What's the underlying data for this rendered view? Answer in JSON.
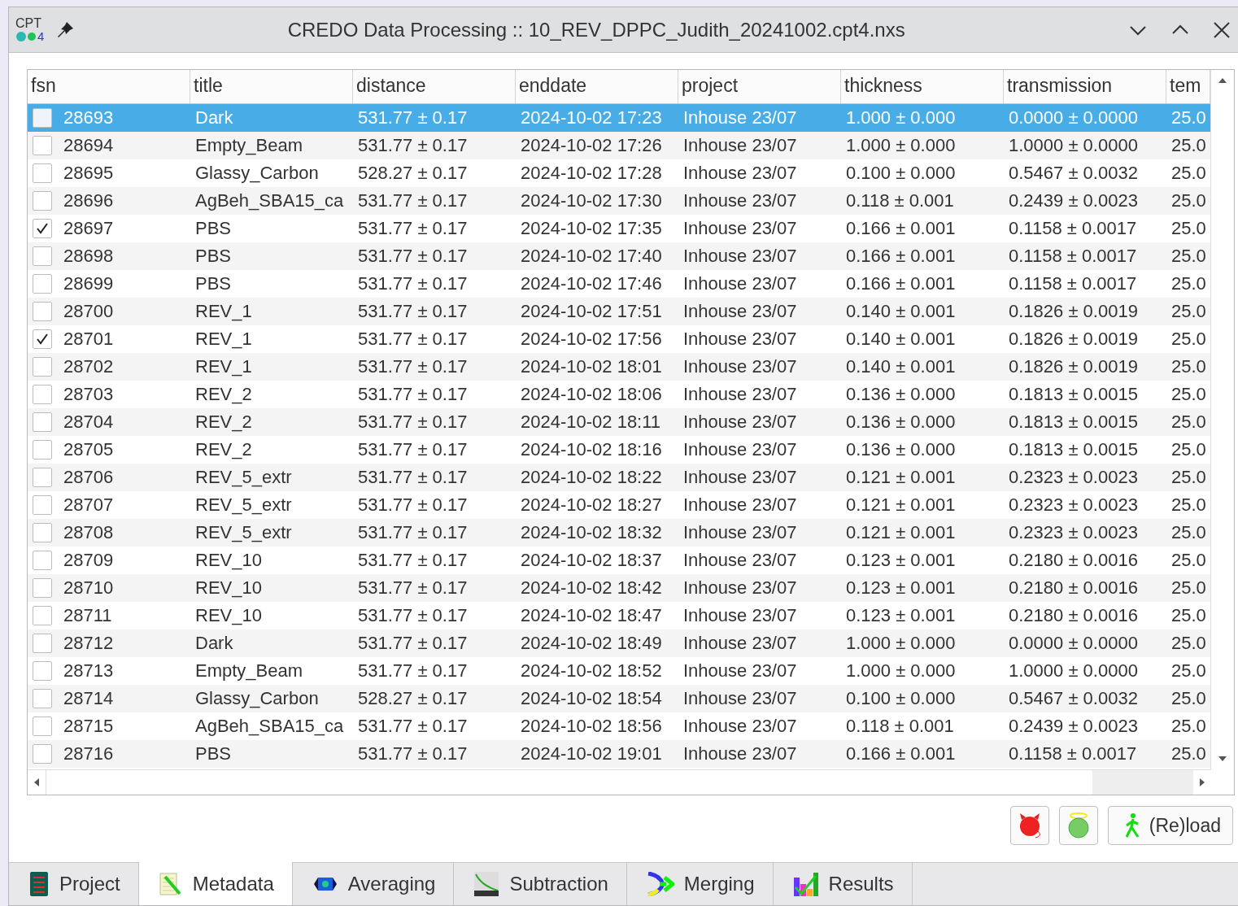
{
  "window": {
    "app_icon_text": "CPT",
    "app_icon_version": "4",
    "title": "CREDO Data Processing :: 10_REV_DPPC_Judith_20241002.cpt4.nxs"
  },
  "table": {
    "columns": [
      "fsn",
      "title",
      "distance",
      "enddate",
      "project",
      "thickness",
      "transmission",
      "tem"
    ],
    "rows": [
      {
        "checked": false,
        "selected": true,
        "cells": [
          "28693",
          "Dark",
          "531.77 ± 0.17",
          "2024-10-02 17:23",
          "Inhouse 23/07",
          "1.000 ± 0.000",
          "0.0000 ± 0.0000",
          "25.0"
        ]
      },
      {
        "checked": false,
        "selected": false,
        "cells": [
          "28694",
          "Empty_Beam",
          "531.77 ± 0.17",
          "2024-10-02 17:26",
          "Inhouse 23/07",
          "1.000 ± 0.000",
          "1.0000 ± 0.0000",
          "25.0"
        ]
      },
      {
        "checked": false,
        "selected": false,
        "cells": [
          "28695",
          "Glassy_Carbon",
          "528.27 ± 0.17",
          "2024-10-02 17:28",
          "Inhouse 23/07",
          "0.100 ± 0.000",
          "0.5467 ± 0.0032",
          "25.0"
        ]
      },
      {
        "checked": false,
        "selected": false,
        "cells": [
          "28696",
          "AgBeh_SBA15_ca",
          "531.77 ± 0.17",
          "2024-10-02 17:30",
          "Inhouse 23/07",
          "0.118 ± 0.001",
          "0.2439 ± 0.0023",
          "25.0"
        ]
      },
      {
        "checked": true,
        "selected": false,
        "cells": [
          "28697",
          "PBS",
          "531.77 ± 0.17",
          "2024-10-02 17:35",
          "Inhouse 23/07",
          "0.166 ± 0.001",
          "0.1158 ± 0.0017",
          "25.0"
        ]
      },
      {
        "checked": false,
        "selected": false,
        "cells": [
          "28698",
          "PBS",
          "531.77 ± 0.17",
          "2024-10-02 17:40",
          "Inhouse 23/07",
          "0.166 ± 0.001",
          "0.1158 ± 0.0017",
          "25.0"
        ]
      },
      {
        "checked": false,
        "selected": false,
        "cells": [
          "28699",
          "PBS",
          "531.77 ± 0.17",
          "2024-10-02 17:46",
          "Inhouse 23/07",
          "0.166 ± 0.001",
          "0.1158 ± 0.0017",
          "25.0"
        ]
      },
      {
        "checked": false,
        "selected": false,
        "cells": [
          "28700",
          "REV_1",
          "531.77 ± 0.17",
          "2024-10-02 17:51",
          "Inhouse 23/07",
          "0.140 ± 0.001",
          "0.1826 ± 0.0019",
          "25.0"
        ]
      },
      {
        "checked": true,
        "selected": false,
        "cells": [
          "28701",
          "REV_1",
          "531.77 ± 0.17",
          "2024-10-02 17:56",
          "Inhouse 23/07",
          "0.140 ± 0.001",
          "0.1826 ± 0.0019",
          "25.0"
        ]
      },
      {
        "checked": false,
        "selected": false,
        "cells": [
          "28702",
          "REV_1",
          "531.77 ± 0.17",
          "2024-10-02 18:01",
          "Inhouse 23/07",
          "0.140 ± 0.001",
          "0.1826 ± 0.0019",
          "25.0"
        ]
      },
      {
        "checked": false,
        "selected": false,
        "cells": [
          "28703",
          "REV_2",
          "531.77 ± 0.17",
          "2024-10-02 18:06",
          "Inhouse 23/07",
          "0.136 ± 0.000",
          "0.1813 ± 0.0015",
          "25.0"
        ]
      },
      {
        "checked": false,
        "selected": false,
        "cells": [
          "28704",
          "REV_2",
          "531.77 ± 0.17",
          "2024-10-02 18:11",
          "Inhouse 23/07",
          "0.136 ± 0.000",
          "0.1813 ± 0.0015",
          "25.0"
        ]
      },
      {
        "checked": false,
        "selected": false,
        "cells": [
          "28705",
          "REV_2",
          "531.77 ± 0.17",
          "2024-10-02 18:16",
          "Inhouse 23/07",
          "0.136 ± 0.000",
          "0.1813 ± 0.0015",
          "25.0"
        ]
      },
      {
        "checked": false,
        "selected": false,
        "cells": [
          "28706",
          "REV_5_extr",
          "531.77 ± 0.17",
          "2024-10-02 18:22",
          "Inhouse 23/07",
          "0.121 ± 0.001",
          "0.2323 ± 0.0023",
          "25.0"
        ]
      },
      {
        "checked": false,
        "selected": false,
        "cells": [
          "28707",
          "REV_5_extr",
          "531.77 ± 0.17",
          "2024-10-02 18:27",
          "Inhouse 23/07",
          "0.121 ± 0.001",
          "0.2323 ± 0.0023",
          "25.0"
        ]
      },
      {
        "checked": false,
        "selected": false,
        "cells": [
          "28708",
          "REV_5_extr",
          "531.77 ± 0.17",
          "2024-10-02 18:32",
          "Inhouse 23/07",
          "0.121 ± 0.001",
          "0.2323 ± 0.0023",
          "25.0"
        ]
      },
      {
        "checked": false,
        "selected": false,
        "cells": [
          "28709",
          "REV_10",
          "531.77 ± 0.17",
          "2024-10-02 18:37",
          "Inhouse 23/07",
          "0.123 ± 0.001",
          "0.2180 ± 0.0016",
          "25.0"
        ]
      },
      {
        "checked": false,
        "selected": false,
        "cells": [
          "28710",
          "REV_10",
          "531.77 ± 0.17",
          "2024-10-02 18:42",
          "Inhouse 23/07",
          "0.123 ± 0.001",
          "0.2180 ± 0.0016",
          "25.0"
        ]
      },
      {
        "checked": false,
        "selected": false,
        "cells": [
          "28711",
          "REV_10",
          "531.77 ± 0.17",
          "2024-10-02 18:47",
          "Inhouse 23/07",
          "0.123 ± 0.001",
          "0.2180 ± 0.0016",
          "25.0"
        ]
      },
      {
        "checked": false,
        "selected": false,
        "cells": [
          "28712",
          "Dark",
          "531.77 ± 0.17",
          "2024-10-02 18:49",
          "Inhouse 23/07",
          "1.000 ± 0.000",
          "0.0000 ± 0.0000",
          "25.0"
        ]
      },
      {
        "checked": false,
        "selected": false,
        "cells": [
          "28713",
          "Empty_Beam",
          "531.77 ± 0.17",
          "2024-10-02 18:52",
          "Inhouse 23/07",
          "1.000 ± 0.000",
          "1.0000 ± 0.0000",
          "25.0"
        ]
      },
      {
        "checked": false,
        "selected": false,
        "cells": [
          "28714",
          "Glassy_Carbon",
          "528.27 ± 0.17",
          "2024-10-02 18:54",
          "Inhouse 23/07",
          "0.100 ± 0.000",
          "0.5467 ± 0.0032",
          "25.0"
        ]
      },
      {
        "checked": false,
        "selected": false,
        "cells": [
          "28715",
          "AgBeh_SBA15_ca",
          "531.77 ± 0.17",
          "2024-10-02 18:56",
          "Inhouse 23/07",
          "0.118 ± 0.001",
          "0.2439 ± 0.0023",
          "25.0"
        ]
      },
      {
        "checked": false,
        "selected": false,
        "cells": [
          "28716",
          "PBS",
          "531.77 ± 0.17",
          "2024-10-02 19:01",
          "Inhouse 23/07",
          "0.166 ± 0.001",
          "0.1158 ± 0.0017",
          "25.0"
        ]
      }
    ]
  },
  "buttons": [
    {
      "kind": "bad"
    },
    {
      "kind": "good"
    },
    {
      "kind": "reload",
      "label": "(Re)load"
    }
  ],
  "tabs": [
    {
      "kind": "project",
      "label": "Project",
      "selected": false
    },
    {
      "kind": "metadata",
      "label": "Metadata",
      "selected": true
    },
    {
      "kind": "averaging",
      "label": "Averaging",
      "selected": false
    },
    {
      "kind": "subtraction",
      "label": "Subtraction",
      "selected": false
    },
    {
      "kind": "merging",
      "label": "Merging",
      "selected": false
    },
    {
      "kind": "results",
      "label": "Results",
      "selected": false
    }
  ]
}
